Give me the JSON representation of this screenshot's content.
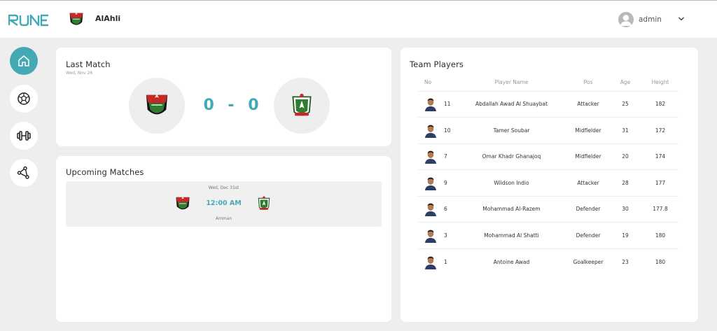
{
  "brand": {
    "logo_text": "RUNE",
    "accent_color": "#43aab5"
  },
  "header": {
    "club_name": "AlAhli",
    "username": "admin"
  },
  "sidebar": {
    "items": [
      {
        "icon": "home-icon",
        "active": true
      },
      {
        "icon": "soccer-ball-icon",
        "active": false
      },
      {
        "icon": "dumbbell-icon",
        "active": false
      },
      {
        "icon": "network-icon",
        "active": false
      }
    ]
  },
  "last_match": {
    "title": "Last Match",
    "date": "Wed, Nov 26",
    "home_score": "0",
    "separator": "-",
    "away_score": "0"
  },
  "upcoming": {
    "title": "Upcoming Matches",
    "date": "Wed, Dec 31st",
    "time": "12:00 AM",
    "venue": "Amman"
  },
  "team_players": {
    "title": "Team Players",
    "columns": [
      "No",
      "Player Name",
      "Pos",
      "Age",
      "Height"
    ],
    "rows": [
      {
        "no": "11",
        "name": "Abdallah Awad Al Shuaybat",
        "pos": "Attacker",
        "age": "25",
        "height": "182"
      },
      {
        "no": "10",
        "name": "Tamer Soubar",
        "pos": "Midfielder",
        "age": "31",
        "height": "172"
      },
      {
        "no": "7",
        "name": "Omar Khadr Ghanajoq",
        "pos": "Midfielder",
        "age": "20",
        "height": "174"
      },
      {
        "no": "9",
        "name": "Wildson Indio",
        "pos": "Attacker",
        "age": "28",
        "height": "177"
      },
      {
        "no": "6",
        "name": "Mohammad Al-Razem",
        "pos": "Defender",
        "age": "30",
        "height": "177.8"
      },
      {
        "no": "3",
        "name": "Mohammad Al Shatti",
        "pos": "Defender",
        "age": "19",
        "height": "180"
      },
      {
        "no": "1",
        "name": "Antoine Awad",
        "pos": "Goalkeeper",
        "age": "23",
        "height": "180"
      }
    ]
  }
}
